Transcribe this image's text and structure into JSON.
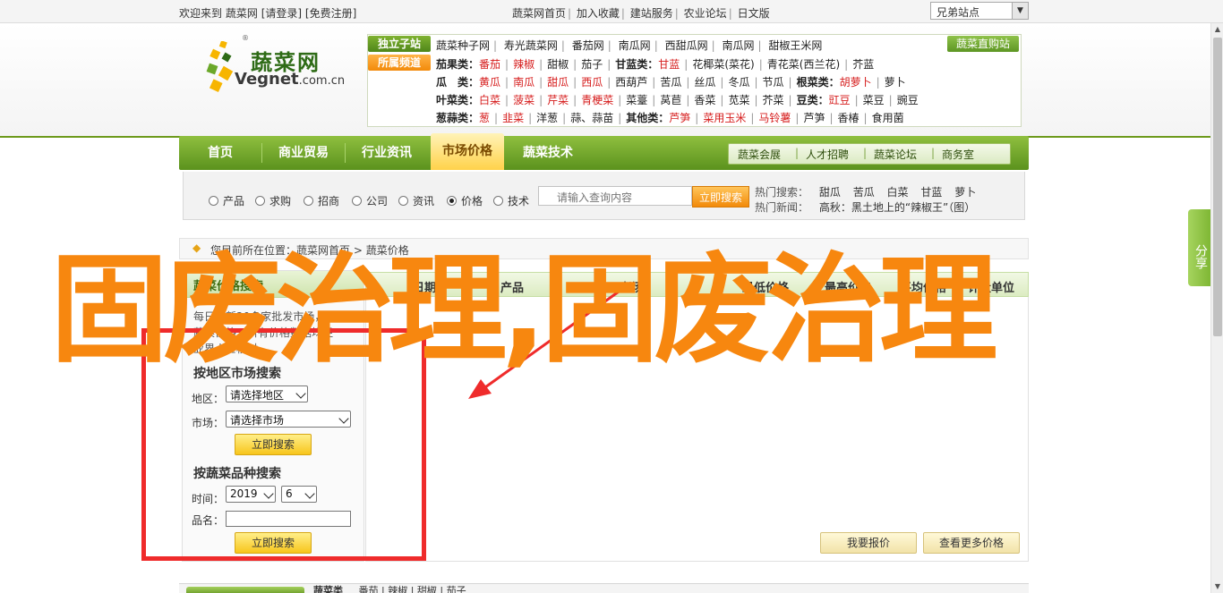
{
  "topbar": {
    "welcome": "欢迎来到",
    "site_name": "蔬菜网",
    "login": "[请登录]",
    "register": "[免费注册]",
    "links": [
      "蔬菜网首页",
      "加入收藏",
      "建站服务",
      "农业论坛",
      "日文版"
    ],
    "site_select": "兄弟站点"
  },
  "logo": {
    "cn": "蔬菜网",
    "en_main": "Vegnet",
    "en_suffix": ".com.cn",
    "reg": "®"
  },
  "categories": {
    "tag_green": "独立子站",
    "tag_orange": "所属频道",
    "first_line": [
      "蔬菜种子网",
      "寿光蔬菜网",
      "番茄网",
      "南瓜网",
      "西甜瓜网",
      "南瓜网",
      "甜椒王米网"
    ],
    "direct": "蔬菜直购站",
    "rows": [
      {
        "label": "茄果类：",
        "items": [
          {
            "t": "番茄",
            "r": true
          },
          {
            "t": "辣椒",
            "r": true
          },
          {
            "t": "甜椒",
            "r": false
          },
          {
            "t": "茄子",
            "r": false
          }
        ],
        "label2": "甘蓝类：",
        "items2": [
          {
            "t": "甘蓝",
            "r": true
          },
          {
            "t": "花椰菜(菜花)",
            "r": false
          },
          {
            "t": "青花菜(西兰花)",
            "r": false
          },
          {
            "t": "芥蓝",
            "r": false
          }
        ]
      },
      {
        "label": "瓜　类：",
        "items": [
          {
            "t": "黄瓜",
            "r": true
          },
          {
            "t": "南瓜",
            "r": true
          },
          {
            "t": "甜瓜",
            "r": true
          },
          {
            "t": "西瓜",
            "r": true
          },
          {
            "t": "西葫芦",
            "r": false
          },
          {
            "t": "苦瓜",
            "r": false
          },
          {
            "t": "丝瓜",
            "r": false
          },
          {
            "t": "冬瓜",
            "r": false
          },
          {
            "t": "节瓜",
            "r": false
          }
        ],
        "label2": "根菜类：",
        "items2": [
          {
            "t": "胡萝卜",
            "r": true
          },
          {
            "t": "萝卜",
            "r": false
          }
        ]
      },
      {
        "label": "叶菜类：",
        "items": [
          {
            "t": "白菜",
            "r": true
          },
          {
            "t": "菠菜",
            "r": true
          },
          {
            "t": "芹菜",
            "r": true
          },
          {
            "t": "青梗菜",
            "r": true
          },
          {
            "t": "菜薹",
            "r": false
          },
          {
            "t": "莴苣",
            "r": false
          },
          {
            "t": "香菜",
            "r": false
          },
          {
            "t": "苋菜",
            "r": false
          },
          {
            "t": "芥菜",
            "r": false
          }
        ],
        "label2": "豆类：",
        "items2": [
          {
            "t": "豇豆",
            "r": true
          },
          {
            "t": "菜豆",
            "r": false
          },
          {
            "t": "豌豆",
            "r": false
          }
        ]
      },
      {
        "label": "葱蒜类：",
        "items": [
          {
            "t": "葱",
            "r": true
          },
          {
            "t": "韭菜",
            "r": true
          },
          {
            "t": "洋葱",
            "r": false
          },
          {
            "t": "蒜、蒜苗",
            "r": false
          }
        ],
        "label2": "其他类：",
        "items2": [
          {
            "t": "芦笋",
            "r": true
          },
          {
            "t": "菜用玉米",
            "r": true
          },
          {
            "t": "马铃薯",
            "r": true
          },
          {
            "t": "芦笋",
            "r": false
          },
          {
            "t": "香椿",
            "r": false
          },
          {
            "t": "食用菌",
            "r": false
          }
        ]
      }
    ]
  },
  "nav": {
    "items": [
      "首页",
      "商业贸易",
      "行业资讯",
      "市场价格",
      "蔬菜技术"
    ],
    "active": "市场价格",
    "sub": [
      "蔬菜会展",
      "人才招聘",
      "蔬菜论坛",
      "商务室"
    ]
  },
  "search": {
    "options": [
      "产品",
      "求购",
      "招商",
      "公司",
      "资讯",
      "价格",
      "技术"
    ],
    "selected": "价格",
    "placeholder": "请输入查询内容",
    "button": "立即搜索",
    "hot_label": "热门搜索：",
    "hot_items": [
      "甜瓜",
      "苦瓜",
      "白菜",
      "甘蓝",
      "萝卜"
    ],
    "news_label": "热门新闻：",
    "news_item": "高秋：黑土地上的“辣椒王”（图）"
  },
  "breadcrumb": {
    "prefix": "您目前所在位置：",
    "home": "蔬菜网首页",
    "sep": ">",
    "current": "蔬菜价格"
  },
  "left_panel": {
    "header": "蔬菜价格搜索",
    "line1": "每日更新20多家批发市场，上百种",
    "line2": "蔬菜价格，所有价格数据均经",
    "line3": "业界人士校对。",
    "region_title": "按地区市场搜索",
    "region_label": "地区：",
    "region_value": "请选择地区",
    "market_label": "市场：",
    "market_value": "请选择市场",
    "btn1": "立即搜索",
    "variety_title": "按蔬菜品种搜索",
    "time_label": "时间：",
    "year": "2019",
    "month": "6",
    "name_label": "品名：",
    "btn2": "立即搜索"
  },
  "table": {
    "headers": [
      "日期",
      "产品",
      "市场",
      "最低价格",
      "最高价格",
      "平均价格",
      "计量单位"
    ],
    "btn_report": "我要报价",
    "btn_more": "查看更多价格"
  },
  "bottom": {
    "text": "蔬菜类",
    "items": [
      "番茄",
      "辣椒",
      "甜椒",
      "茄子"
    ]
  },
  "share": "分享",
  "overlay": {
    "text": "固废治理,固废治理",
    "color": "#f7870f",
    "frame_color": "#ef2b2b"
  }
}
